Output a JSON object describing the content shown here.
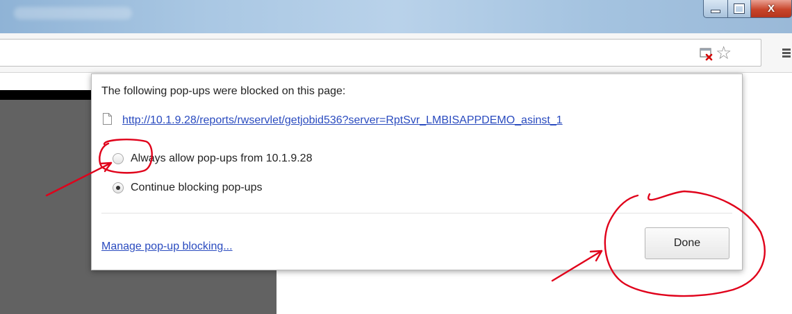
{
  "window": {
    "controls": {
      "minimize": "minimize",
      "maximize": "maximize",
      "close": "X"
    }
  },
  "toolbar": {
    "icons": [
      "popup-blocked-icon",
      "bookmark-star-icon",
      "menu-icon"
    ]
  },
  "bubble": {
    "heading": "The following pop-ups were blocked on this page:",
    "blocked_url": "http://10.1.9.28/reports/rwservlet/getjobid536?server=RptSvr_LMBISAPPDEMO_asinst_1",
    "options": [
      {
        "label": "Always allow pop-ups from 10.1.9.28",
        "selected": false
      },
      {
        "label": "Continue blocking pop-ups",
        "selected": true
      }
    ],
    "manage_link": "Manage pop-up blocking...",
    "done_label": "Done"
  },
  "colors": {
    "link": "#2a4bbf",
    "annotation": "#e0001a"
  }
}
